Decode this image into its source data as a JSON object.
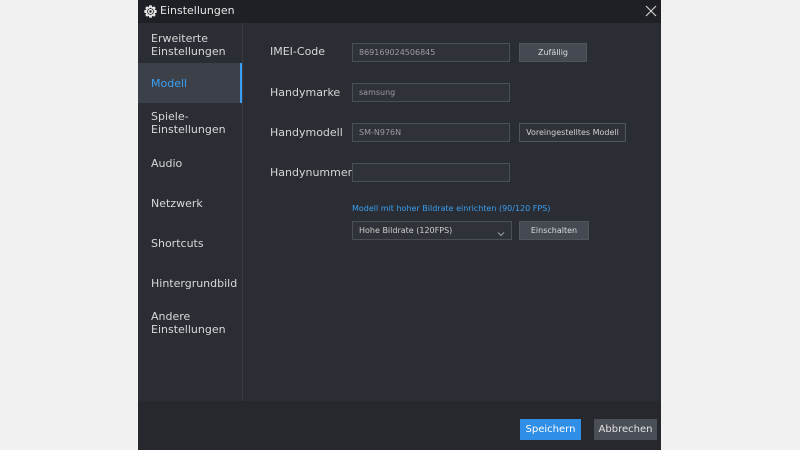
{
  "window": {
    "title": "Einstellungen",
    "icon": "gear-icon",
    "close_icon": "close-icon"
  },
  "sidebar": {
    "items": [
      {
        "label": "Erweiterte\nEinstellungen",
        "active": false
      },
      {
        "label": "Modell",
        "active": true
      },
      {
        "label": "Spiele-\nEinstellungen",
        "active": false
      },
      {
        "label": "Audio",
        "active": false
      },
      {
        "label": "Netzwerk",
        "active": false
      },
      {
        "label": "Shortcuts",
        "active": false
      },
      {
        "label": "Hintergrundbild",
        "active": false
      },
      {
        "label": "Andere\nEinstellungen",
        "active": false
      }
    ]
  },
  "model": {
    "imei": {
      "label": "IMEI-Code",
      "value": "869169024506845",
      "button": "Zufällig"
    },
    "brand": {
      "label": "Handymarke",
      "value": "samsung"
    },
    "device": {
      "label": "Handymodell",
      "value": "SM-N976N",
      "button": "Voreingestelltes Modell"
    },
    "phone": {
      "label": "Handynummer",
      "value": ""
    },
    "high_fps": {
      "link": "Modell mit hoher Bildrate einrichten (90/120 FPS)",
      "selected": "Hohe Bildrate (120FPS)",
      "button": "Einschalten"
    }
  },
  "footer": {
    "save": "Speichern",
    "cancel": "Abbrechen"
  },
  "colors": {
    "accent": "#2f8ee6",
    "link": "#3a9ff2",
    "background": "#2a2d33",
    "titlebar": "#1e2025"
  }
}
